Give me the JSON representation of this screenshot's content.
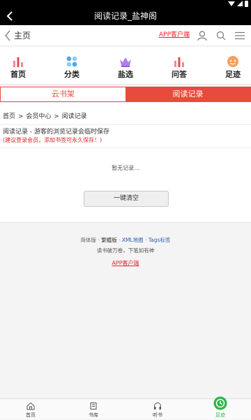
{
  "titlebar": {
    "title": "阅读记录_盐神阁"
  },
  "header": {
    "home_label": "主页",
    "app_link": "APP客户端"
  },
  "nav": {
    "items": [
      {
        "label": "首页"
      },
      {
        "label": "分类"
      },
      {
        "label": "盐选"
      },
      {
        "label": "问答"
      },
      {
        "label": "足迹"
      }
    ]
  },
  "tabs": {
    "cloud": "云书架",
    "history": "阅读记录"
  },
  "breadcrumb": {
    "home": "首页",
    "sep": ">",
    "member": "会员中心",
    "current": "阅读记录"
  },
  "content": {
    "info": "阅读记录 - 游客的浏览记录会临时保存",
    "warn": "(建议登录会员，添加书签可永久保存！)",
    "empty": "暂无记录...",
    "clear_button": "一键清空"
  },
  "footer": {
    "simplified": "简体版",
    "dot": "·",
    "traditional": "繁體版",
    "xml": "XML地图",
    "tags": "Tags标签",
    "slogan": "读书破万卷，下笔如有神",
    "app_link": "APP客户端"
  },
  "bottom_nav": {
    "items": [
      {
        "label": "首页"
      },
      {
        "label": "书库"
      },
      {
        "label": "听书"
      },
      {
        "label": "足迹"
      }
    ]
  },
  "colors": {
    "accent": "#e84b3d",
    "active_green": "#2fb34a"
  }
}
